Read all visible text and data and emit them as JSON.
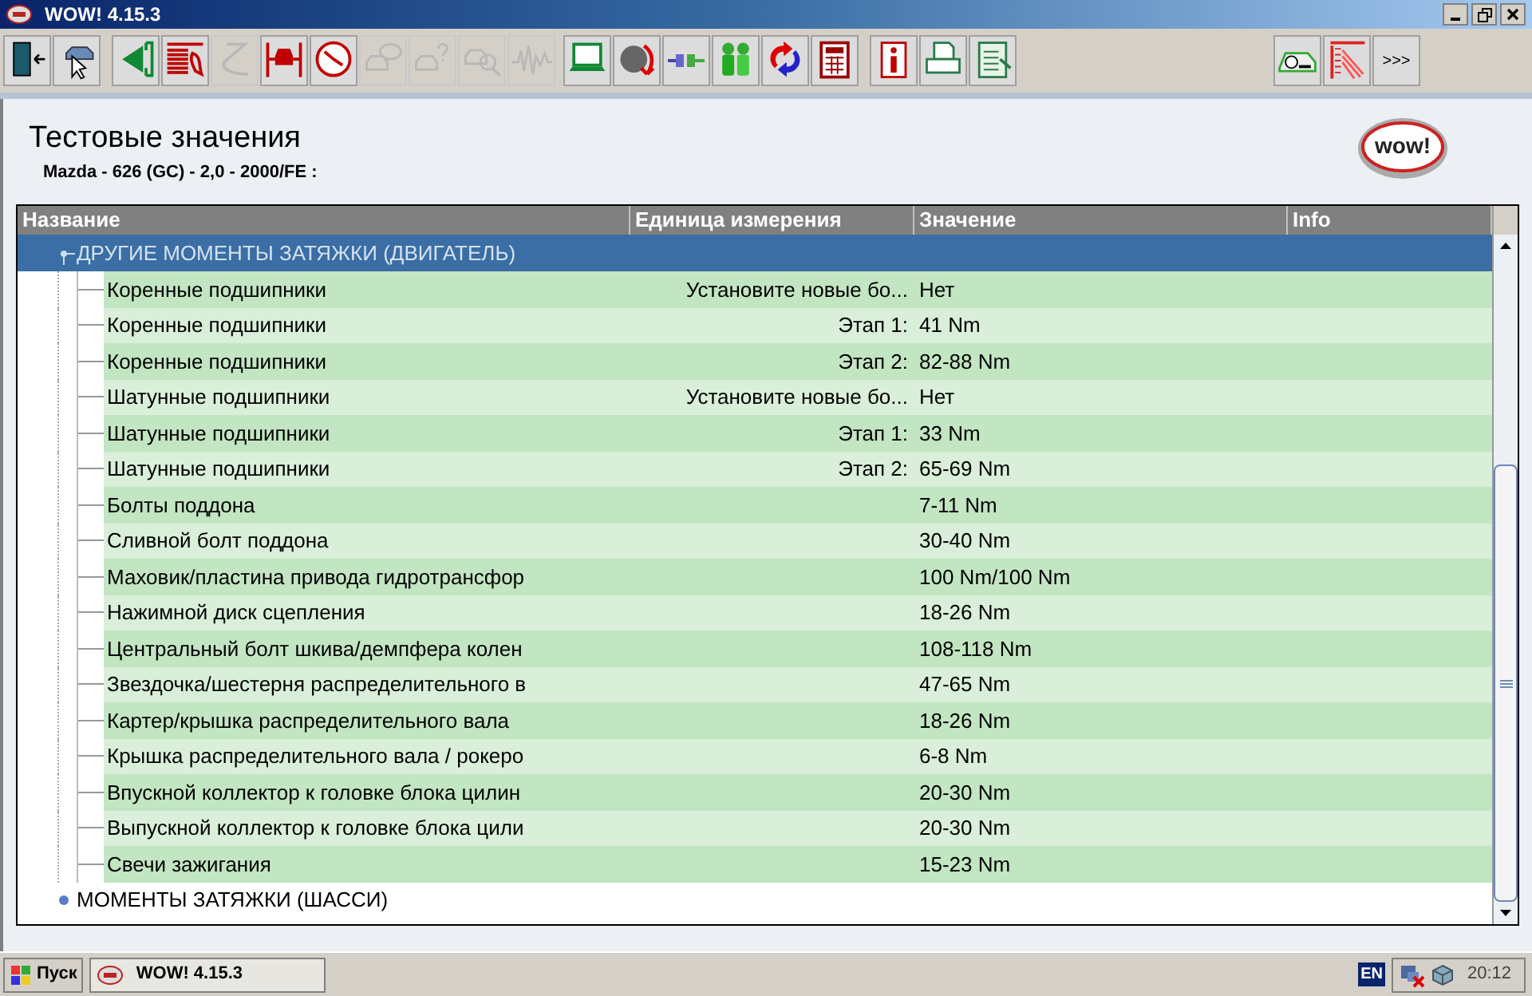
{
  "window": {
    "title": "WOW! 4.15.3"
  },
  "toolbar": [
    {
      "disabled": false
    },
    {
      "disabled": false
    },
    {
      "disabled": false
    },
    {
      "disabled": false
    },
    {
      "disabled": true
    },
    {
      "disabled": false
    },
    {
      "disabled": false
    },
    {
      "disabled": true
    },
    {
      "disabled": true
    },
    {
      "disabled": true
    },
    {
      "disabled": true
    },
    {
      "disabled": false
    },
    {
      "disabled": false
    },
    {
      "disabled": false
    },
    {
      "disabled": false
    },
    {
      "disabled": false
    },
    {
      "disabled": false
    },
    {
      "disabled": false
    },
    {
      "disabled": false
    },
    {
      "disabled": false
    },
    {
      "disabled": false
    },
    {
      "disabled": false
    }
  ],
  "toolbar_more": ">>>",
  "page": {
    "logo": "wow!",
    "title": "Тестовые значения",
    "vehicle": "Mazda - 626 (GC) - 2,0 - 2000/FE :"
  },
  "table": {
    "columns": [
      "Название",
      "Единица измерения",
      "Значение",
      "Info"
    ],
    "groups": [
      {
        "label": "ДРУГИЕ МОМЕНТЫ ЗАТЯЖКИ (ДВИГАТЕЛЬ)",
        "selected": true,
        "expanded": true,
        "rows": [
          {
            "name": "Коренные подшипники",
            "unit": "Установите новые бо...",
            "value": "Нет"
          },
          {
            "name": "Коренные подшипники",
            "unit": "Этап 1:",
            "value": "41 Nm"
          },
          {
            "name": "Коренные подшипники",
            "unit": "Этап 2:",
            "value": "82-88 Nm"
          },
          {
            "name": "Шатунные подшипники",
            "unit": "Установите новые бо...",
            "value": "Нет"
          },
          {
            "name": "Шатунные подшипники",
            "unit": "Этап 1:",
            "value": "33 Nm"
          },
          {
            "name": "Шатунные подшипники",
            "unit": "Этап 2:",
            "value": "65-69 Nm"
          },
          {
            "name": "Болты поддона",
            "value": "7-11 Nm"
          },
          {
            "name": "Сливной болт поддона",
            "value": "30-40 Nm"
          },
          {
            "name": "Маховик/пластина привода гидротрансфор",
            "value": "100 Nm/100 Nm"
          },
          {
            "name": "Нажимной диск сцепления",
            "value": "18-26 Nm"
          },
          {
            "name": "Центральный болт шкива/демпфера колен",
            "value": "108-118 Nm"
          },
          {
            "name": "Звездочка/шестерня распределительного в",
            "value": "47-65 Nm"
          },
          {
            "name": "Картер/крышка распределительного вала",
            "value": "18-26 Nm"
          },
          {
            "name": "Крышка распределительного вала / рокеро",
            "value": "6-8 Nm"
          },
          {
            "name": "Впускной коллектор к головке блока цилин",
            "value": "20-30 Nm"
          },
          {
            "name": "Выпускной коллектор к головке блока цили",
            "value": "20-30 Nm"
          },
          {
            "name": "Свечи зажигания",
            "value": "15-23 Nm"
          }
        ]
      },
      {
        "label": "МОМЕНТЫ ЗАТЯЖКИ (ШАССИ)",
        "selected": false,
        "expanded": false
      }
    ]
  },
  "taskbar": {
    "start": "Пуск",
    "task": "WOW! 4.15.3",
    "language": "EN",
    "clock": "20:12"
  }
}
